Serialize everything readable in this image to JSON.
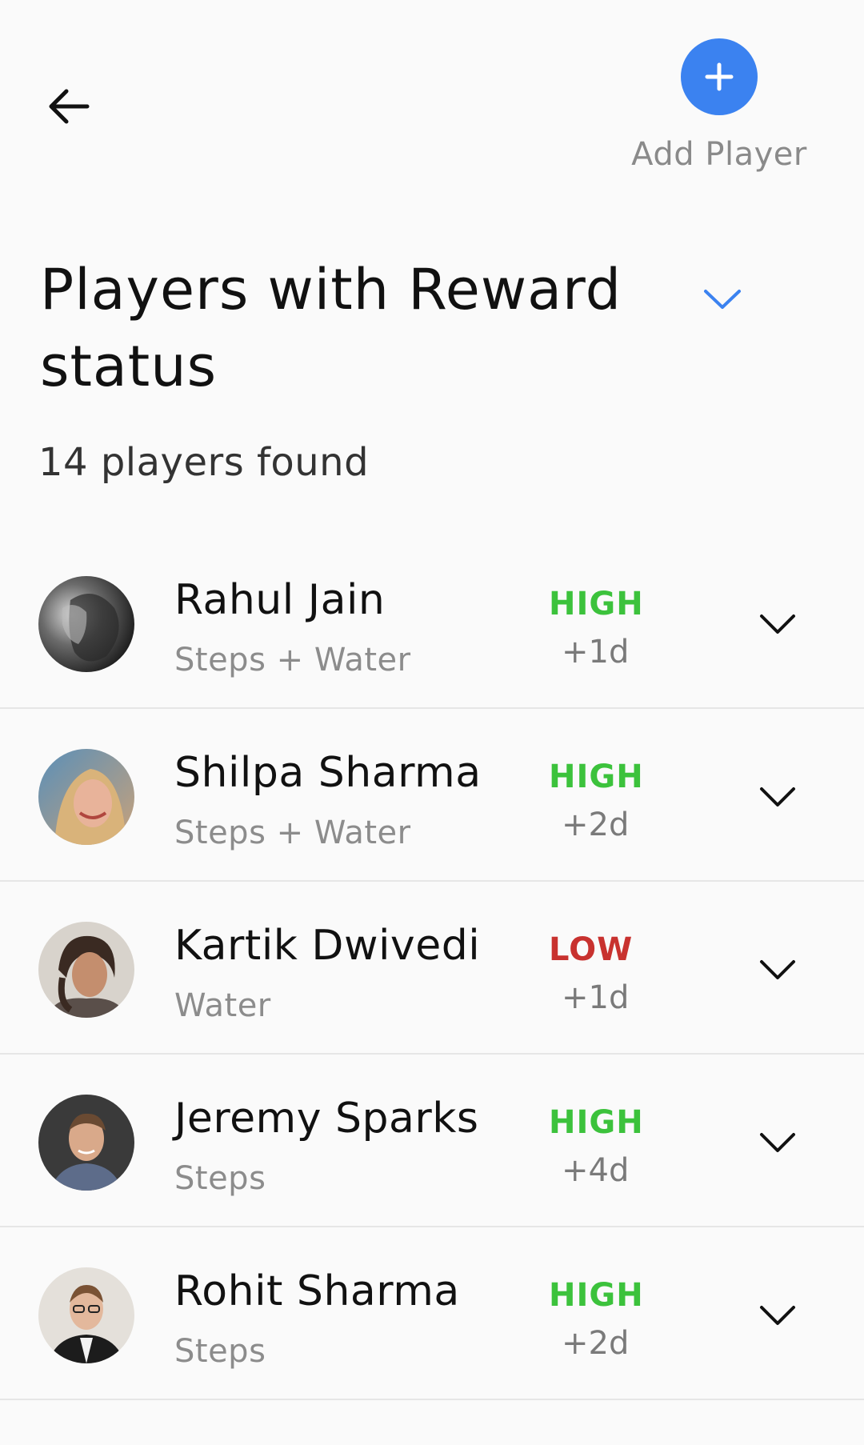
{
  "header": {
    "back_icon": "arrow-left-icon",
    "add_icon": "plus-icon",
    "add_label": "Add Player",
    "accent_color": "#3b82f0"
  },
  "title": {
    "text": "Players with Reward status",
    "dropdown_icon": "chevron-down-icon"
  },
  "summary": {
    "count_text": "14 players found"
  },
  "colors": {
    "high": "#3cc23c",
    "low": "#c8322f"
  },
  "players": [
    {
      "name": "Rahul Jain",
      "goals": "Steps + Water",
      "status": "HIGH",
      "duration": "+1d",
      "avatar_icon": "avatar-photo"
    },
    {
      "name": "Shilpa Sharma",
      "goals": "Steps + Water",
      "status": "HIGH",
      "duration": "+2d",
      "avatar_icon": "avatar-photo"
    },
    {
      "name": "Kartik Dwivedi",
      "goals": "Water",
      "status": "LOW",
      "duration": "+1d",
      "avatar_icon": "avatar-photo"
    },
    {
      "name": "Jeremy Sparks",
      "goals": "Steps",
      "status": "HIGH",
      "duration": "+4d",
      "avatar_icon": "avatar-photo"
    },
    {
      "name": "Rohit Sharma",
      "goals": "Steps",
      "status": "HIGH",
      "duration": "+2d",
      "avatar_icon": "avatar-photo"
    }
  ]
}
